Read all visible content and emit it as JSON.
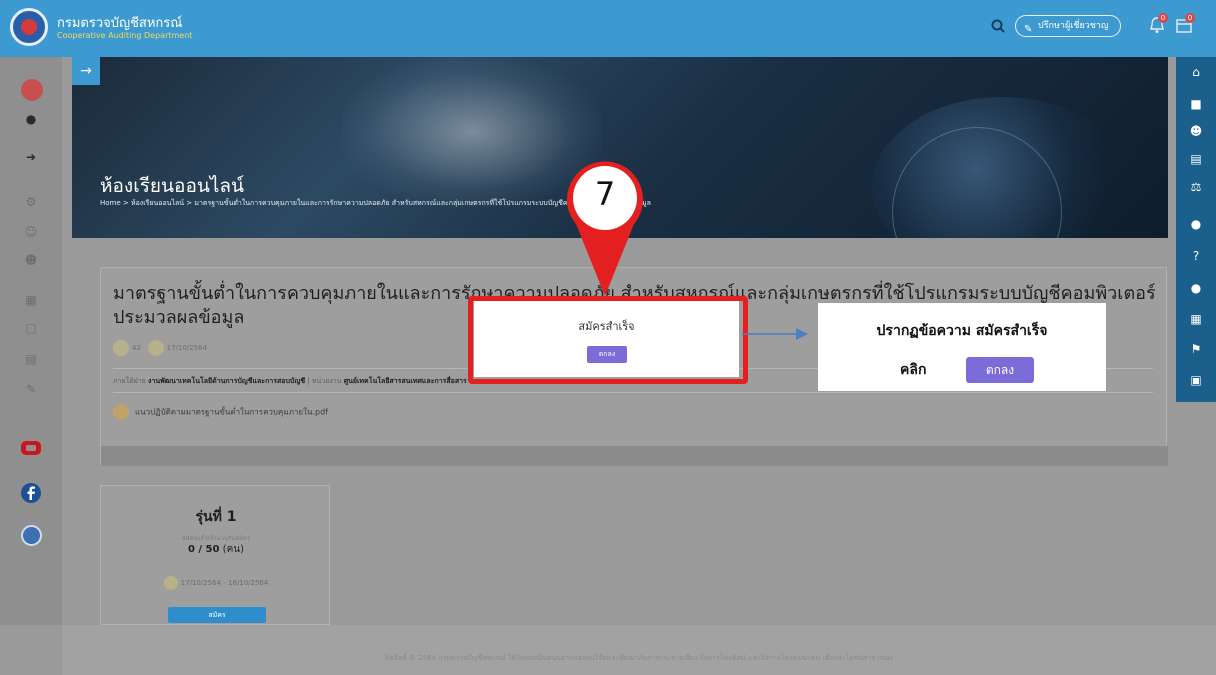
{
  "header": {
    "brand_th": "กรมตรวจบัญชีสหกรณ์",
    "brand_en": "Cooperative Auditing Department",
    "consult_label": "ปรึกษาผู้เชี่ยวชาญ",
    "notif_count": "0",
    "calendar_count": "0"
  },
  "banner": {
    "title": "ห้องเรียนออนไลน์",
    "breadcrumb": "Home > ห้องเรียนออนไลน์ > มาตรฐานขั้นต่ำในการควบคุมภายในและการรักษาความปลอดภัย สำหรับสหกรณ์และกลุ่มเกษตรกรที่ใช้โปรแกรมระบบบัญชีคอมพิวเตอร์ประมวลผลข้อมูล"
  },
  "course": {
    "title": "มาตรฐานขั้นต่ำในการควบคุมภายในและการรักษาความปลอดภัย สำหรับสหกรณ์และกลุ่มเกษตรกรที่ใช้โปรแกรมระบบบัญชีคอมพิวเตอร์ประมวลผลข้อมูล",
    "views": "42",
    "date": "17/10/2564",
    "division_label": "ภายใต้ฝ่าย",
    "division": "งานพัฒนาเทคโนโลยีด้านการบัญชีและการสอบบัญชี",
    "unit_label": "หน่วยงาน",
    "unit": "ศูนย์เทคโนโลยีสารสนเทศและการสื่อสาร",
    "attachment": "แนวปฏิบัติตามมาตรฐานขั้นต่ำในการควบคุมภายใน.pdf"
  },
  "round": {
    "title": "รุ่นที่ 1",
    "sub": "สมัครแล้ว/จำนวนรับสมัคร",
    "count": "0 / 50",
    "unit": "(คน)",
    "dates": "17/10/2564 - 18/10/2564",
    "apply_label": "สมัคร"
  },
  "footer": {
    "text": "ลิขสิทธิ์ © 2564 กรมตรวจบัญชีสหกรณ์ ได้รับทุนสนับสนุนจากกองทุนวิจัยและพัฒนากิจการกระจายเสียง กิจการโทรทัศน์ และกิจการโทรคมนาคม เพื่อประโยชน์สาธารณะ"
  },
  "modal": {
    "title": "สมัครสำเร็จ",
    "ok_label": "ตกลง"
  },
  "annotation": {
    "step": "7",
    "line1": "ปรากฏข้อความ สมัครสำเร็จ",
    "line2": "คลิก",
    "ok_label": "ตกลง"
  },
  "colors": {
    "topbar": "#3d9ad1",
    "right_sidebar": "#1b5f8c",
    "highlight": "#e41f1f",
    "ok_button": "#7b6cd8"
  }
}
